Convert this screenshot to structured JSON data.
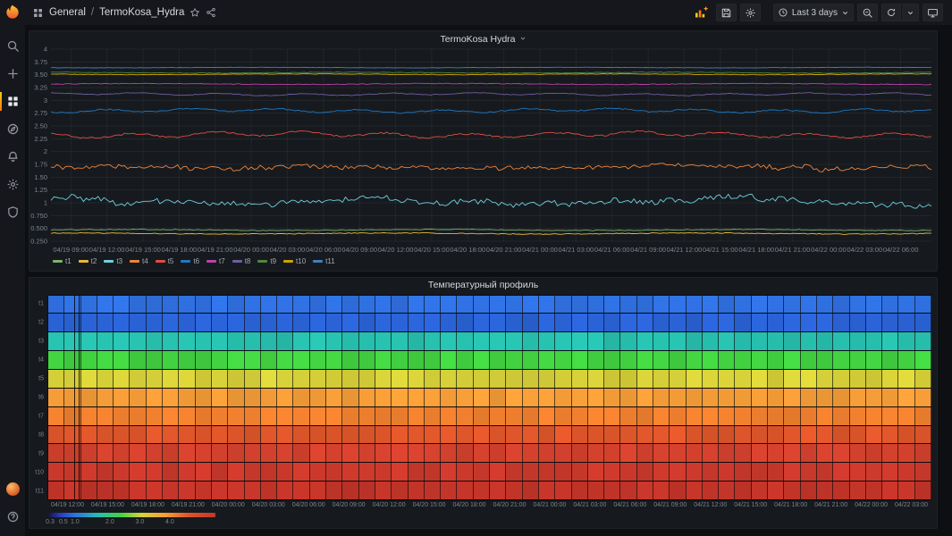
{
  "navbar": {
    "breadcrumb": {
      "section": "General",
      "separator": "/",
      "title": "TermoKosa_Hydra"
    },
    "time_picker": {
      "label": "Last 3 days"
    }
  },
  "sidebar": {
    "top": [
      {
        "name": "search",
        "icon": "search"
      },
      {
        "name": "create",
        "icon": "plus"
      },
      {
        "name": "dashboards",
        "icon": "apps",
        "active": true
      },
      {
        "name": "explore",
        "icon": "compass"
      },
      {
        "name": "alerting",
        "icon": "bell"
      },
      {
        "name": "configuration",
        "icon": "gear"
      },
      {
        "name": "server-admin",
        "icon": "shield"
      }
    ],
    "bottom": [
      {
        "name": "profile",
        "icon": "avatar"
      },
      {
        "name": "help",
        "icon": "question"
      }
    ]
  },
  "panels": [
    {
      "title": "TermoKosa Hydra"
    },
    {
      "title": "Температурный профиль"
    }
  ],
  "colors": {
    "accent_orange": "#ff780a",
    "panel_bg": "#161a1e",
    "page_bg": "#0d0f12"
  },
  "chart_data": [
    {
      "type": "line",
      "title": "TermoKosa Hydra",
      "xlabel": "",
      "ylabel": "",
      "ylim": [
        0.25,
        4.0
      ],
      "grid": true,
      "legend_position": "bottom",
      "y_ticks": [
        "4",
        "3.75",
        "3.50",
        "3.25",
        "3",
        "2.75",
        "2.50",
        "2.25",
        "2",
        "1.75",
        "1.50",
        "1.25",
        "1",
        "0.750",
        "0.500",
        "0.250"
      ],
      "x_ticks": [
        "04/19 09:00",
        "04/19 12:00",
        "04/19 15:00",
        "04/19 18:00",
        "04/19 21:00",
        "04/20 00:00",
        "04/20 03:00",
        "04/20 06:00",
        "04/20 09:00",
        "04/20 12:00",
        "04/20 15:00",
        "04/20 18:00",
        "04/20 21:00",
        "04/21 00:00",
        "04/21 03:00",
        "04/21 06:00",
        "04/21 09:00",
        "04/21 12:00",
        "04/21 15:00",
        "04/21 18:00",
        "04/21 21:00",
        "04/22 00:00",
        "04/22 03:00",
        "04/22 06:00"
      ],
      "series": [
        {
          "name": "t1",
          "color": "#7EB26D",
          "mean": 0.47,
          "amp": 0.02,
          "style": "flat"
        },
        {
          "name": "t2",
          "color": "#EAB839",
          "mean": 0.4,
          "amp": 0.02,
          "style": "flat"
        },
        {
          "name": "t3",
          "color": "#6ED0E0",
          "mean": 1.03,
          "amp": 0.07,
          "style": "noisy"
        },
        {
          "name": "t4",
          "color": "#EF843C",
          "mean": 1.7,
          "amp": 0.055,
          "style": "noisy"
        },
        {
          "name": "t5",
          "color": "#E24D42",
          "mean": 2.33,
          "amp": 0.05,
          "style": "wavy"
        },
        {
          "name": "t6",
          "color": "#1F78C1",
          "mean": 2.8,
          "amp": 0.035,
          "style": "wavy"
        },
        {
          "name": "t7",
          "color": "#BA43A9",
          "mean": 3.32,
          "amp": 0.018,
          "style": "flat"
        },
        {
          "name": "t8",
          "color": "#705DA0",
          "mean": 3.12,
          "amp": 0.022,
          "style": "wavy"
        },
        {
          "name": "t9",
          "color": "#508642",
          "mean": 3.54,
          "amp": 0.016,
          "style": "flat"
        },
        {
          "name": "t10",
          "color": "#CCA300",
          "mean": 3.51,
          "amp": 0.016,
          "style": "flat"
        },
        {
          "name": "t11",
          "color": "#447EBC",
          "mean": 3.64,
          "amp": 0.01,
          "style": "flat"
        }
      ]
    },
    {
      "type": "heatmap",
      "title": "Температурный профиль",
      "columns": 54,
      "rows": [
        {
          "label": "t1",
          "value": 0.47,
          "color": "#3071e2"
        },
        {
          "label": "t2",
          "value": 0.4,
          "color": "#2b63d6"
        },
        {
          "label": "t3",
          "value": 1.03,
          "color": "#27c0ae"
        },
        {
          "label": "t4",
          "value": 1.7,
          "color": "#43d342"
        },
        {
          "label": "t5",
          "value": 2.33,
          "color": "#d8d23a"
        },
        {
          "label": "t6",
          "value": 2.8,
          "color": "#f59d38"
        },
        {
          "label": "t7",
          "value": 3.32,
          "color": "#f0802f"
        },
        {
          "label": "t8",
          "value": 3.12,
          "color": "#e1572b"
        },
        {
          "label": "t9",
          "value": 3.54,
          "color": "#d4422e"
        },
        {
          "label": "t10",
          "value": 3.51,
          "color": "#cb392c"
        },
        {
          "label": "t11",
          "value": 3.64,
          "color": "#c33529"
        }
      ],
      "x_ticks": [
        "04/19 12:00",
        "04/19 15:00",
        "04/19 18:00",
        "04/19 21:00",
        "04/20 00:00",
        "04/20 03:00",
        "04/20 06:00",
        "04/20 09:00",
        "04/20 12:00",
        "04/20 15:00",
        "04/20 18:00",
        "04/20 21:00",
        "04/21 00:00",
        "04/21 03:00",
        "04/21 06:00",
        "04/21 09:00",
        "04/21 12:00",
        "04/21 15:00",
        "04/21 18:00",
        "04/21 21:00",
        "04/22 00:00",
        "04/22 03:00"
      ],
      "annotations": [
        {
          "pos": 0.029
        },
        {
          "pos": 0.034
        }
      ],
      "colorbar": {
        "ticks": [
          {
            "label": "0.3",
            "pos": 0.0
          },
          {
            "label": "0.5",
            "pos": 0.08
          },
          {
            "label": "1.0",
            "pos": 0.15
          },
          {
            "label": "2.0",
            "pos": 0.36
          },
          {
            "label": "3.0",
            "pos": 0.54
          },
          {
            "label": "4.0",
            "pos": 0.72
          }
        ]
      }
    }
  ]
}
